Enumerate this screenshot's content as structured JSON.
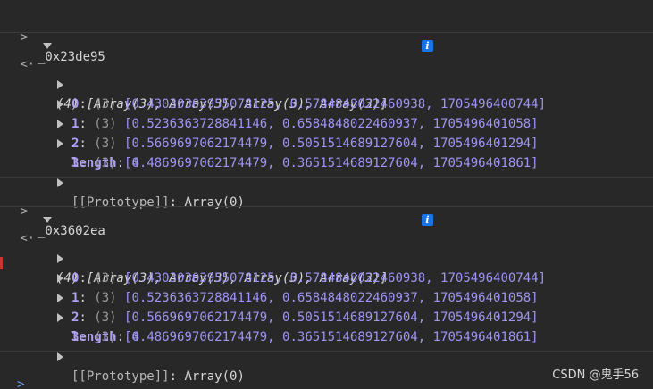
{
  "blocks": [
    {
      "expression": "_0x23de95",
      "summary": "(4) [Array(3), Array(3), Array(3), Array(3)]",
      "rows": [
        {
          "index": "0",
          "count": "(3)",
          "values": "[0.43030303955078125, 0.5784848022460938, 1705496400744]"
        },
        {
          "index": "1",
          "count": "(3)",
          "values": "[0.5236363728841146, 0.6584848022460937, 1705496401058]"
        },
        {
          "index": "2",
          "count": "(3)",
          "values": "[0.5669697062174479, 0.5051514689127604, 1705496401294]"
        },
        {
          "index": "3",
          "count": "(3)",
          "values": "[0.4869697062174479, 0.3651514689127604, 1705496401861]"
        }
      ],
      "length_label": "length",
      "length_value": "4",
      "prototype_label": "[[Prototype]]",
      "prototype_value": "Array(0)"
    },
    {
      "expression": "_0x3602ea",
      "summary": "(4) [Array(3), Array(3), Array(3), Array(3)]",
      "rows": [
        {
          "index": "0",
          "count": "(3)",
          "values": "[0.43030303955078125, 0.5784848022460938, 1705496400744]"
        },
        {
          "index": "1",
          "count": "(3)",
          "values": "[0.5236363728841146, 0.6584848022460937, 1705496401058]"
        },
        {
          "index": "2",
          "count": "(3)",
          "values": "[0.5669697062174479, 0.5051514689127604, 1705496401294]"
        },
        {
          "index": "3",
          "count": "(3)",
          "values": "[0.4869697062174479, 0.3651514689127604, 1705496401861]"
        }
      ],
      "length_label": "length",
      "length_value": "4",
      "prototype_label": "[[Prototype]]",
      "prototype_value": "Array(0)"
    }
  ],
  "icons": {
    "input_arrow": "chevron-right-icon",
    "result_arrow": "return-arrow-icon",
    "info": "info-icon",
    "prompt": "prompt-chevron-icon"
  },
  "colors": {
    "background": "#282828",
    "number": "#9e95f5",
    "key": "#b0a0f0",
    "info_badge": "#1a73e8",
    "prompt": "#6b9bf5"
  },
  "watermark": "CSDN @鬼手56"
}
